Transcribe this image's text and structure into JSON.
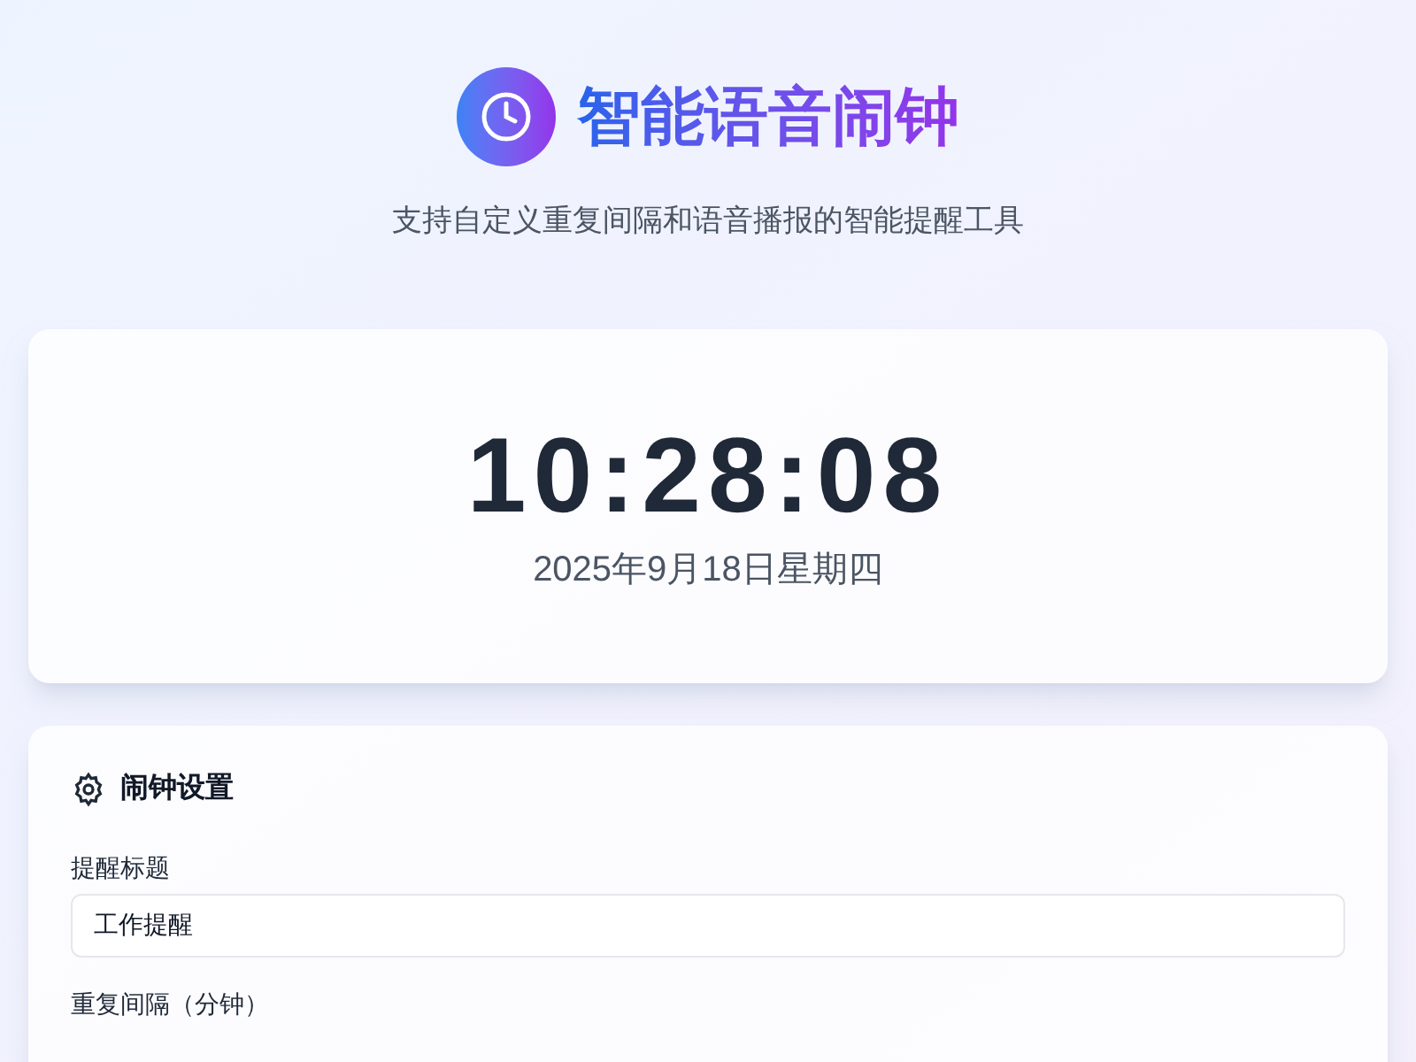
{
  "header": {
    "title": "智能语音闹钟",
    "subtitle": "支持自定义重复间隔和语音播报的智能提醒工具"
  },
  "clock": {
    "time": "10:28:08",
    "date": "2025年9月18日星期四"
  },
  "settings": {
    "title": "闹钟设置",
    "fields": [
      {
        "label": "提醒标题",
        "value": "工作提醒"
      },
      {
        "label": "重复间隔（分钟）"
      }
    ]
  }
}
